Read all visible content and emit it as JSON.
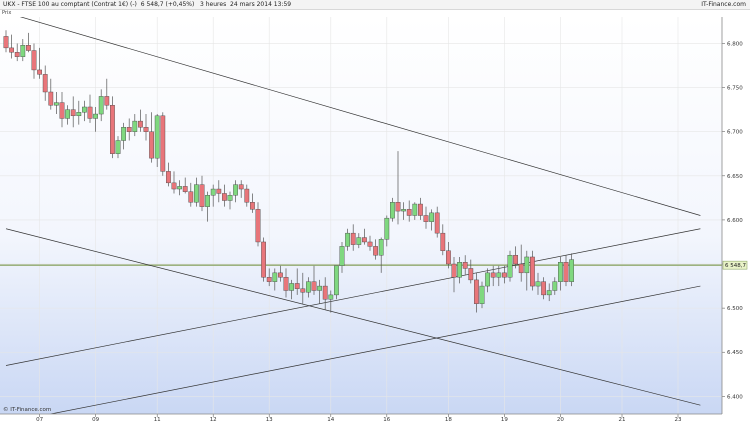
{
  "header": {
    "instrument": "UKX - FTSE 100 au comptant (Contrat 1€) (-)",
    "last": "6 548,7 (+0,45%)",
    "period": "3 heures",
    "datetime": "24 mars 2014 13:59",
    "brand": "IT-Finance.com"
  },
  "prix_label": "Prix",
  "watermark": "© IT-Finance.com",
  "chart_data": {
    "type": "candlestick",
    "title": "UKX - FTSE 100 au comptant (Contrat 1€) (-)",
    "ylim": [
      6380,
      6830
    ],
    "y_ticks": [
      6800,
      6750,
      6700,
      6650,
      6600,
      6550,
      6500,
      6450,
      6400
    ],
    "y_tick_labels": [
      "6.800",
      "6.750",
      "6.700",
      "6.650",
      "6.600",
      "6.550",
      "6.500",
      "6.450",
      "6.400"
    ],
    "x_tick_labels": [
      "07",
      "09",
      "11",
      "12",
      "13",
      "14",
      "16",
      "18",
      "19",
      "20",
      "21",
      "23"
    ],
    "x_tick_index": [
      6,
      16,
      27,
      37,
      47,
      58,
      68,
      79,
      89,
      99,
      110,
      120
    ],
    "last_value": 6548.7,
    "last_label": "6 548,7",
    "colors": {
      "up": "#7fd87f",
      "down": "#e8757a",
      "wick": "#555555",
      "grid": "#e6e6e6",
      "level": "#8fa86b"
    },
    "grid": true,
    "candles": [
      [
        6808,
        6815,
        6790,
        6795
      ],
      [
        6795,
        6810,
        6783,
        6790
      ],
      [
        6790,
        6800,
        6780,
        6785
      ],
      [
        6785,
        6805,
        6780,
        6798
      ],
      [
        6798,
        6812,
        6790,
        6792
      ],
      [
        6792,
        6800,
        6760,
        6770
      ],
      [
        6770,
        6795,
        6760,
        6765
      ],
      [
        6765,
        6775,
        6735,
        6745
      ],
      [
        6745,
        6760,
        6725,
        6730
      ],
      [
        6730,
        6745,
        6720,
        6733
      ],
      [
        6733,
        6745,
        6705,
        6715
      ],
      [
        6715,
        6730,
        6708,
        6725
      ],
      [
        6725,
        6740,
        6705,
        6718
      ],
      [
        6718,
        6735,
        6708,
        6722
      ],
      [
        6722,
        6735,
        6712,
        6728
      ],
      [
        6728,
        6742,
        6710,
        6715
      ],
      [
        6715,
        6728,
        6700,
        6720
      ],
      [
        6720,
        6748,
        6712,
        6740
      ],
      [
        6740,
        6760,
        6725,
        6730
      ],
      [
        6730,
        6740,
        6670,
        6675
      ],
      [
        6675,
        6695,
        6670,
        6690
      ],
      [
        6690,
        6710,
        6680,
        6705
      ],
      [
        6705,
        6715,
        6690,
        6700
      ],
      [
        6700,
        6720,
        6695,
        6712
      ],
      [
        6712,
        6725,
        6700,
        6705
      ],
      [
        6705,
        6720,
        6690,
        6700
      ],
      [
        6700,
        6722,
        6665,
        6670
      ],
      [
        6670,
        6720,
        6660,
        6718
      ],
      [
        6718,
        6722,
        6650,
        6655
      ],
      [
        6655,
        6665,
        6638,
        6642
      ],
      [
        6642,
        6655,
        6630,
        6635
      ],
      [
        6635,
        6645,
        6628,
        6638
      ],
      [
        6638,
        6648,
        6630,
        6632
      ],
      [
        6632,
        6642,
        6615,
        6620
      ],
      [
        6620,
        6648,
        6615,
        6640
      ],
      [
        6640,
        6650,
        6610,
        6615
      ],
      [
        6615,
        6632,
        6598,
        6628
      ],
      [
        6628,
        6640,
        6615,
        6635
      ],
      [
        6635,
        6645,
        6620,
        6630
      ],
      [
        6630,
        6640,
        6615,
        6622
      ],
      [
        6622,
        6632,
        6612,
        6628
      ],
      [
        6628,
        6645,
        6620,
        6640
      ],
      [
        6640,
        6645,
        6625,
        6635
      ],
      [
        6635,
        6640,
        6615,
        6620
      ],
      [
        6620,
        6630,
        6608,
        6612
      ],
      [
        6612,
        6620,
        6570,
        6575
      ],
      [
        6575,
        6580,
        6530,
        6535
      ],
      [
        6535,
        6545,
        6525,
        6530
      ],
      [
        6530,
        6545,
        6520,
        6540
      ],
      [
        6540,
        6548,
        6530,
        6535
      ],
      [
        6535,
        6545,
        6512,
        6520
      ],
      [
        6520,
        6532,
        6510,
        6528
      ],
      [
        6528,
        6545,
        6515,
        6522
      ],
      [
        6522,
        6540,
        6505,
        6518
      ],
      [
        6518,
        6535,
        6512,
        6530
      ],
      [
        6530,
        6548,
        6515,
        6520
      ],
      [
        6520,
        6532,
        6505,
        6525
      ],
      [
        6525,
        6535,
        6498,
        6510
      ],
      [
        6510,
        6520,
        6495,
        6515
      ],
      [
        6515,
        6545,
        6510,
        6548
      ],
      [
        6548,
        6575,
        6540,
        6570
      ],
      [
        6570,
        6590,
        6565,
        6585
      ],
      [
        6585,
        6595,
        6565,
        6572
      ],
      [
        6572,
        6585,
        6568,
        6580
      ],
      [
        6580,
        6590,
        6572,
        6575
      ],
      [
        6575,
        6582,
        6565,
        6570
      ],
      [
        6570,
        6578,
        6555,
        6560
      ],
      [
        6560,
        6580,
        6540,
        6578
      ],
      [
        6578,
        6605,
        6570,
        6602
      ],
      [
        6602,
        6625,
        6598,
        6620
      ],
      [
        6620,
        6678,
        6595,
        6610
      ],
      [
        6610,
        6620,
        6600,
        6612
      ],
      [
        6612,
        6622,
        6598,
        6605
      ],
      [
        6605,
        6620,
        6600,
        6618
      ],
      [
        6618,
        6625,
        6600,
        6605
      ],
      [
        6605,
        6615,
        6590,
        6598
      ],
      [
        6598,
        6612,
        6588,
        6608
      ],
      [
        6608,
        6615,
        6580,
        6585
      ],
      [
        6585,
        6595,
        6560,
        6565
      ],
      [
        6565,
        6575,
        6545,
        6550
      ],
      [
        6550,
        6558,
        6518,
        6535
      ],
      [
        6535,
        6558,
        6528,
        6552
      ],
      [
        6552,
        6560,
        6538,
        6545
      ],
      [
        6545,
        6555,
        6528,
        6532
      ],
      [
        6532,
        6540,
        6495,
        6505
      ],
      [
        6505,
        6530,
        6500,
        6525
      ],
      [
        6525,
        6545,
        6518,
        6540
      ],
      [
        6540,
        6548,
        6525,
        6535
      ],
      [
        6535,
        6548,
        6525,
        6540
      ],
      [
        6540,
        6548,
        6528,
        6535
      ],
      [
        6535,
        6565,
        6530,
        6560
      ],
      [
        6560,
        6570,
        6545,
        6550
      ],
      [
        6550,
        6572,
        6530,
        6540
      ],
      [
        6540,
        6565,
        6520,
        6558
      ],
      [
        6558,
        6565,
        6520,
        6525
      ],
      [
        6525,
        6540,
        6515,
        6530
      ],
      [
        6530,
        6535,
        6510,
        6515
      ],
      [
        6515,
        6528,
        6508,
        6520
      ],
      [
        6520,
        6535,
        6515,
        6530
      ],
      [
        6530,
        6558,
        6520,
        6552
      ],
      [
        6552,
        6560,
        6525,
        6530
      ],
      [
        6530,
        6562,
        6525,
        6555
      ]
    ],
    "trendlines": [
      {
        "x": [
          0,
          124
        ],
        "y": [
          6835,
          6605
        ]
      },
      {
        "x": [
          0,
          124
        ],
        "y": [
          6590,
          6390
        ]
      },
      {
        "x": [
          0,
          124
        ],
        "y": [
          6435,
          6590
        ]
      },
      {
        "x": [
          8,
          124
        ],
        "y": [
          6380,
          6525
        ]
      }
    ]
  }
}
